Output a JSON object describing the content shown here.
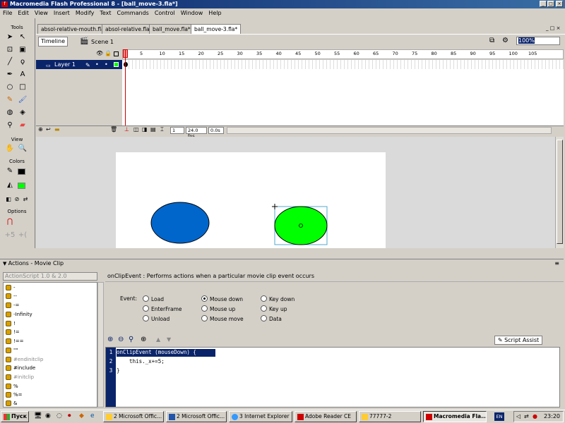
{
  "window": {
    "title": "Macromedia Flash Professional 8 - [ball_move-3.fla*]",
    "icon_text": "f"
  },
  "menu": [
    "File",
    "Edit",
    "View",
    "Insert",
    "Modify",
    "Text",
    "Commands",
    "Control",
    "Window",
    "Help"
  ],
  "tools": {
    "title": "Tools",
    "view_label": "View",
    "colors_label": "Colors",
    "options_label": "Options"
  },
  "doc_tabs": [
    "absol-relative-mouth.fla",
    "absol-relative.fla",
    "ball_move.fla*",
    "ball_move-3.fla*"
  ],
  "edit_bar": {
    "timeline_label": "Timeline",
    "scene_label": "Scene 1",
    "zoom": "100%"
  },
  "timeline": {
    "ruler_ticks": [
      "1",
      "5",
      "10",
      "15",
      "20",
      "25",
      "30",
      "35",
      "40",
      "45",
      "50",
      "55",
      "60",
      "65",
      "70",
      "75",
      "80",
      "85",
      "90",
      "95",
      "100",
      "105"
    ],
    "layer_name": "Layer 1",
    "current_frame": "1",
    "fps": "24.0 fps",
    "time": "0.0s"
  },
  "stage": {
    "left_ellipse_color": "#0066cc",
    "right_ellipse_color": "#00ff00"
  },
  "actions_panel": {
    "header": "Actions - Movie Clip",
    "as_version": "ActionScript 1.0 & 2.0",
    "items": [
      "-",
      "--",
      "-=",
      "-Infinity",
      "!",
      "!=",
      "!==",
      "\"\"",
      "#endinitclip",
      "#include",
      "#initclip",
      "%",
      "%=",
      "&"
    ],
    "help_text": "onClipEvent : Performs actions when a particular movie clip event occurs",
    "event_label": "Event:",
    "events": [
      "Load",
      "EnterFrame",
      "Unload",
      "Mouse down",
      "Mouse up",
      "Mouse move",
      "Key down",
      "Key up",
      "Data"
    ],
    "selected_event": "Mouse down",
    "script_assist_label": "Script Assist",
    "line_numbers": [
      "1",
      "2",
      "3"
    ],
    "code_lines": [
      "onClipEvent (mouseDown) {",
      "    this._x+=5;",
      "}"
    ]
  },
  "taskbar": {
    "start": "Пуск",
    "buttons": [
      "2 Microsoft Offic...",
      "2 Microsoft Offic...",
      "3 Internet Explorer",
      "Adobe Reader CE",
      "77777-2",
      "Macromedia Fla..."
    ],
    "lang": "EN",
    "clock": "23:20"
  }
}
